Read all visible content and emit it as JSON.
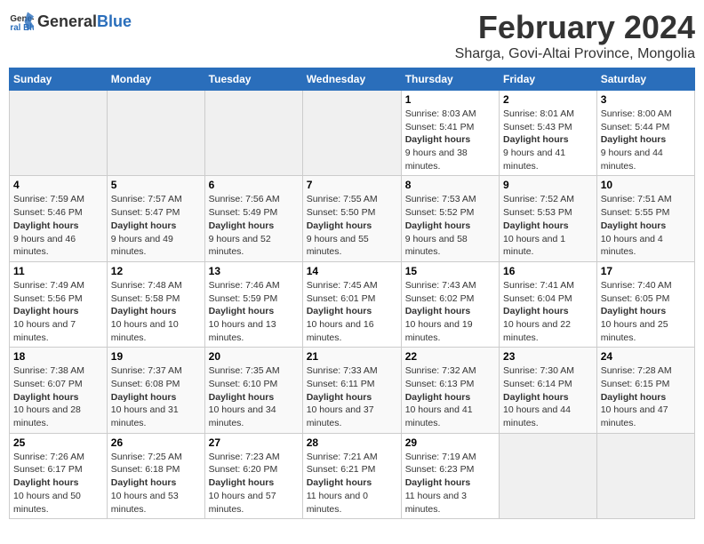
{
  "header": {
    "logo_general": "General",
    "logo_blue": "Blue",
    "month_year": "February 2024",
    "location": "Sharga, Govi-Altai Province, Mongolia"
  },
  "columns": [
    "Sunday",
    "Monday",
    "Tuesday",
    "Wednesday",
    "Thursday",
    "Friday",
    "Saturday"
  ],
  "weeks": [
    {
      "days": [
        {
          "num": "",
          "empty": true
        },
        {
          "num": "",
          "empty": true
        },
        {
          "num": "",
          "empty": true
        },
        {
          "num": "",
          "empty": true
        },
        {
          "num": "1",
          "sunrise": "8:03 AM",
          "sunset": "5:41 PM",
          "daylight": "9 hours and 38 minutes."
        },
        {
          "num": "2",
          "sunrise": "8:01 AM",
          "sunset": "5:43 PM",
          "daylight": "9 hours and 41 minutes."
        },
        {
          "num": "3",
          "sunrise": "8:00 AM",
          "sunset": "5:44 PM",
          "daylight": "9 hours and 44 minutes."
        }
      ]
    },
    {
      "days": [
        {
          "num": "4",
          "sunrise": "7:59 AM",
          "sunset": "5:46 PM",
          "daylight": "9 hours and 46 minutes."
        },
        {
          "num": "5",
          "sunrise": "7:57 AM",
          "sunset": "5:47 PM",
          "daylight": "9 hours and 49 minutes."
        },
        {
          "num": "6",
          "sunrise": "7:56 AM",
          "sunset": "5:49 PM",
          "daylight": "9 hours and 52 minutes."
        },
        {
          "num": "7",
          "sunrise": "7:55 AM",
          "sunset": "5:50 PM",
          "daylight": "9 hours and 55 minutes."
        },
        {
          "num": "8",
          "sunrise": "7:53 AM",
          "sunset": "5:52 PM",
          "daylight": "9 hours and 58 minutes."
        },
        {
          "num": "9",
          "sunrise": "7:52 AM",
          "sunset": "5:53 PM",
          "daylight": "10 hours and 1 minute."
        },
        {
          "num": "10",
          "sunrise": "7:51 AM",
          "sunset": "5:55 PM",
          "daylight": "10 hours and 4 minutes."
        }
      ]
    },
    {
      "days": [
        {
          "num": "11",
          "sunrise": "7:49 AM",
          "sunset": "5:56 PM",
          "daylight": "10 hours and 7 minutes."
        },
        {
          "num": "12",
          "sunrise": "7:48 AM",
          "sunset": "5:58 PM",
          "daylight": "10 hours and 10 minutes."
        },
        {
          "num": "13",
          "sunrise": "7:46 AM",
          "sunset": "5:59 PM",
          "daylight": "10 hours and 13 minutes."
        },
        {
          "num": "14",
          "sunrise": "7:45 AM",
          "sunset": "6:01 PM",
          "daylight": "10 hours and 16 minutes."
        },
        {
          "num": "15",
          "sunrise": "7:43 AM",
          "sunset": "6:02 PM",
          "daylight": "10 hours and 19 minutes."
        },
        {
          "num": "16",
          "sunrise": "7:41 AM",
          "sunset": "6:04 PM",
          "daylight": "10 hours and 22 minutes."
        },
        {
          "num": "17",
          "sunrise": "7:40 AM",
          "sunset": "6:05 PM",
          "daylight": "10 hours and 25 minutes."
        }
      ]
    },
    {
      "days": [
        {
          "num": "18",
          "sunrise": "7:38 AM",
          "sunset": "6:07 PM",
          "daylight": "10 hours and 28 minutes."
        },
        {
          "num": "19",
          "sunrise": "7:37 AM",
          "sunset": "6:08 PM",
          "daylight": "10 hours and 31 minutes."
        },
        {
          "num": "20",
          "sunrise": "7:35 AM",
          "sunset": "6:10 PM",
          "daylight": "10 hours and 34 minutes."
        },
        {
          "num": "21",
          "sunrise": "7:33 AM",
          "sunset": "6:11 PM",
          "daylight": "10 hours and 37 minutes."
        },
        {
          "num": "22",
          "sunrise": "7:32 AM",
          "sunset": "6:13 PM",
          "daylight": "10 hours and 41 minutes."
        },
        {
          "num": "23",
          "sunrise": "7:30 AM",
          "sunset": "6:14 PM",
          "daylight": "10 hours and 44 minutes."
        },
        {
          "num": "24",
          "sunrise": "7:28 AM",
          "sunset": "6:15 PM",
          "daylight": "10 hours and 47 minutes."
        }
      ]
    },
    {
      "days": [
        {
          "num": "25",
          "sunrise": "7:26 AM",
          "sunset": "6:17 PM",
          "daylight": "10 hours and 50 minutes."
        },
        {
          "num": "26",
          "sunrise": "7:25 AM",
          "sunset": "6:18 PM",
          "daylight": "10 hours and 53 minutes."
        },
        {
          "num": "27",
          "sunrise": "7:23 AM",
          "sunset": "6:20 PM",
          "daylight": "10 hours and 57 minutes."
        },
        {
          "num": "28",
          "sunrise": "7:21 AM",
          "sunset": "6:21 PM",
          "daylight": "11 hours and 0 minutes."
        },
        {
          "num": "29",
          "sunrise": "7:19 AM",
          "sunset": "6:23 PM",
          "daylight": "11 hours and 3 minutes."
        },
        {
          "num": "",
          "empty": true
        },
        {
          "num": "",
          "empty": true
        }
      ]
    }
  ],
  "labels": {
    "sunrise": "Sunrise:",
    "sunset": "Sunset:",
    "daylight": "Daylight hours"
  }
}
